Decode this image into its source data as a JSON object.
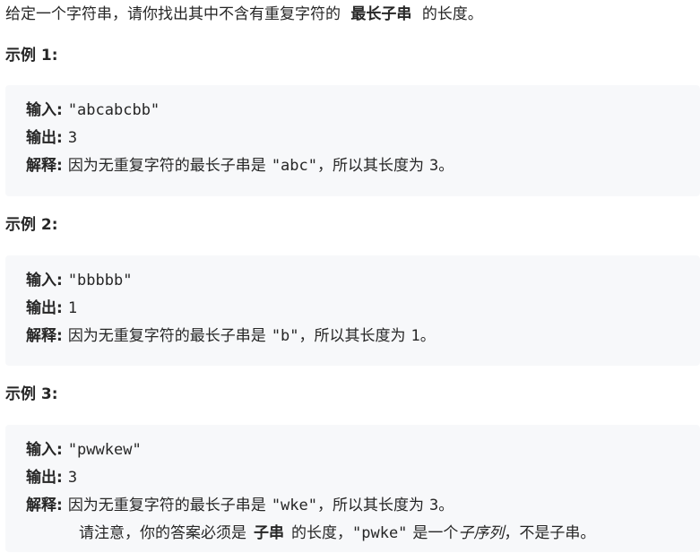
{
  "intro": {
    "before": "给定一个字符串，请你找出其中不含有重复字符的",
    "bold": "最长子串",
    "after": "的长度。"
  },
  "examples": [
    {
      "heading": "示例 1:",
      "input_label": "输入:",
      "input_value": "\"abcabcbb\"",
      "output_label": "输出:",
      "output_value": "3",
      "explain_label": "解释:",
      "explain_before": "因为无重复字符的最长子串是",
      "explain_code": "\"abc\"",
      "explain_middle": "，所以其长度为",
      "explain_code2": "3",
      "explain_end": "。"
    },
    {
      "heading": "示例 2:",
      "input_label": "输入:",
      "input_value": "\"bbbbb\"",
      "output_label": "输出:",
      "output_value": "1",
      "explain_label": "解释:",
      "explain_before": "因为无重复字符的最长子串是",
      "explain_code": "\"b\"",
      "explain_middle": "，所以其长度为",
      "explain_code2": "1",
      "explain_end": "。"
    },
    {
      "heading": "示例 3:",
      "input_label": "输入:",
      "input_value": "\"pwwkew\"",
      "output_label": "输出:",
      "output_value": "3",
      "explain_label": "解释:",
      "explain_before": "因为无重复字符的最长子串是",
      "explain_code": "\"wke\"",
      "explain_middle": "，所以其长度为",
      "explain_code2": "3",
      "explain_end": "。",
      "note": {
        "before": "请注意，你的答案必须是",
        "bold": "子串",
        "middle": "的长度，",
        "code": "\"pwke\"",
        "after": "是一个",
        "italic": "子序列",
        "end": "，不是子串。"
      }
    }
  ]
}
